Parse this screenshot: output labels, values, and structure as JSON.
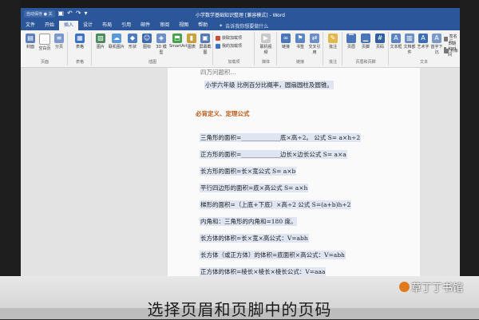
{
  "window": {
    "autosave_label": "自动保存 ● 关",
    "title": "小学数学基础知识整理 [兼容模式] - Word"
  },
  "tabs": [
    "文件",
    "开始",
    "插入",
    "设计",
    "布局",
    "引用",
    "邮件",
    "审阅",
    "视图",
    "帮助"
  ],
  "active_tab_index": 2,
  "tellme": "告诉我你想要做什么",
  "ribbon": {
    "groups": [
      {
        "label": "页面",
        "buttons": [
          "封面",
          "空白页",
          "分页"
        ]
      },
      {
        "label": "表格",
        "buttons": [
          "表格"
        ]
      },
      {
        "label": "插图",
        "buttons": [
          "图片",
          "联机图片",
          "形状",
          "图标",
          "3D 模型",
          "SmartArt",
          "图表",
          "屏幕截图"
        ]
      },
      {
        "label": "加载项",
        "buttons": [
          "获取加载项",
          "我的加载项"
        ]
      },
      {
        "label": "媒体",
        "buttons": [
          "联机视频"
        ]
      },
      {
        "label": "链接",
        "buttons": [
          "链接",
          "书签",
          "交叉引用"
        ]
      },
      {
        "label": "批注",
        "buttons": [
          "批注"
        ]
      },
      {
        "label": "页眉和页脚",
        "buttons": [
          "页眉",
          "页脚",
          "页码"
        ]
      },
      {
        "label": "文本",
        "buttons": [
          "文本框",
          "文档部件",
          "艺术字",
          "首字下沉",
          "签名行",
          "日期和时间",
          "对象"
        ]
      }
    ]
  },
  "document": {
    "top_fragment": "四万问题积…",
    "title": "小学六年级 比例百分比概率，圆扇圆柱及圆锥。",
    "heading": "必背定义、定理公式",
    "lines": [
      "三角形的面积=_____________底×高÷2。 公式 S= a×h÷2",
      "正方形的面积=_____________边长×边长公式 S= a×a",
      "长方形的面积=长×宽公式 S= a×b",
      "平行四边形的面积=底×高公式 S= a×h",
      "梯形的面积=（上底+下底）×高÷2 公式 S=(a+b)h÷2",
      "内角和：三角形的内角和=180 度。",
      "长方体的体积=长×宽×高公式：V=abh",
      "长方体（或正方体）的体积=底面积×高公式：V=abh",
      "正方体的体积=棱长×棱长×棱长公式：V=aaa"
    ]
  },
  "caption": "选择页眉和页脚中的页码",
  "watermark": "草丁丁书馆",
  "colors": {
    "word_blue": "#2b579a",
    "heading_orange": "#c05a13",
    "selection_highlight": "#dfe6f2"
  }
}
